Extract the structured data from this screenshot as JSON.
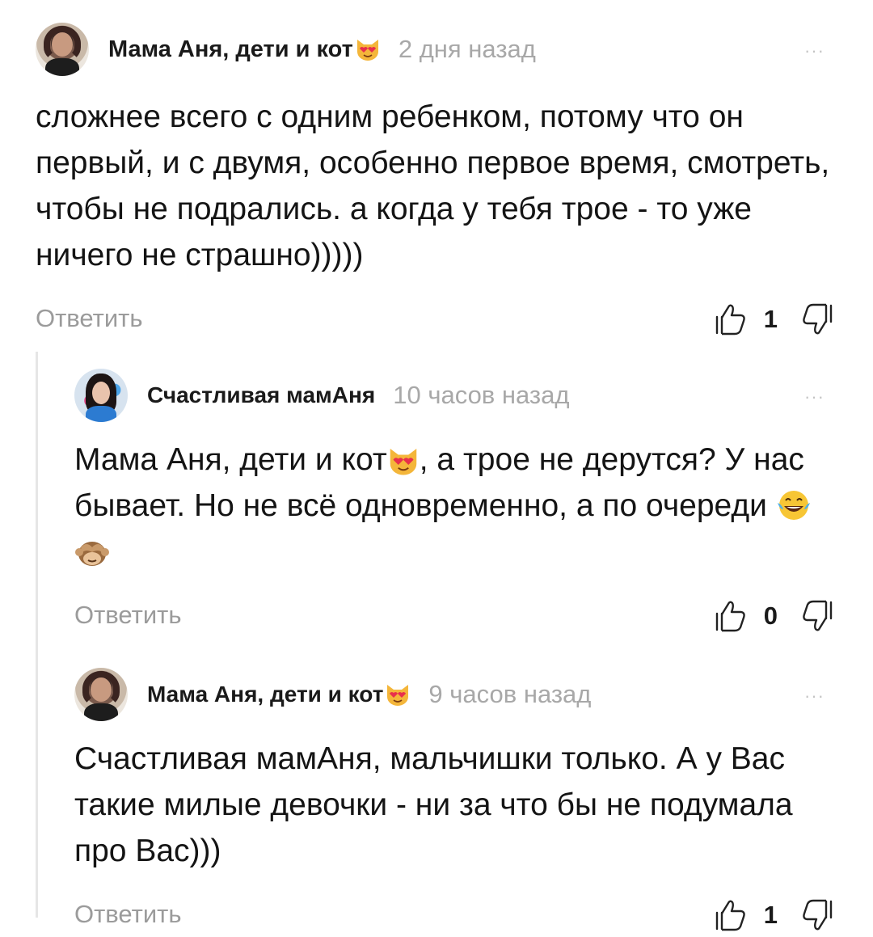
{
  "comments": [
    {
      "author": "Мама Аня, дети и кот",
      "author_emoji": "heart-eyes-cat-icon",
      "time": "2 дня назад",
      "more": "···",
      "text": "сложнее всего с одним ребенком, потому что он первый, и с двумя, особенно первое время, смотреть, чтобы не подрались. а когда у тебя трое - то уже ничего не страшно)))))",
      "reply_label": "Ответить",
      "likes": "1"
    },
    {
      "author": "Счастливая мамАня",
      "time": "10 часов назад",
      "more": "···",
      "text_part1": "Мама Аня, дети и кот",
      "text_part2": ", а трое не дерутся? У нас бывает. Но не всё одновременно, а по очереди ",
      "reply_label": "Ответить",
      "likes": "0"
    },
    {
      "author": "Мама Аня, дети и кот",
      "author_emoji": "heart-eyes-cat-icon",
      "time": "9 часов назад",
      "more": "···",
      "text": "Счастливая мамАня, мальчишки только. А у Вас такие милые девочки - ни за что бы не подумала про Вас)))",
      "reply_label": "Ответить",
      "likes": "1"
    }
  ],
  "colors": {
    "background": "#ffffff",
    "text": "#141414",
    "muted": "#9b9b9b",
    "time": "#a8a8a8",
    "thread_line": "#e6e6e6"
  }
}
